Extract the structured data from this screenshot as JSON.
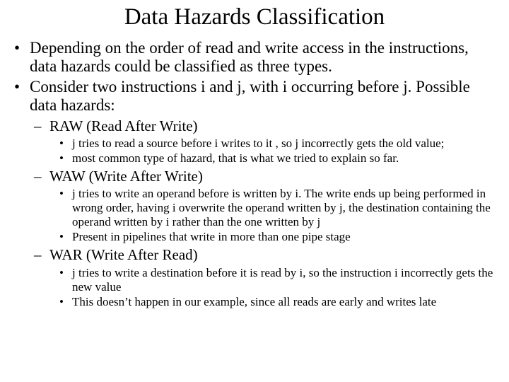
{
  "title": "Data Hazards Classification",
  "bullets": {
    "b1": "Depending on the order of read and write access in the instructions, data hazards could be classified as three types.",
    "b2": "Consider two instructions i and j, with i occurring before j. Possible data hazards:",
    "raw": {
      "heading": "RAW (Read After Write)",
      "p1": "j tries to read a source before i writes to it , so j incorrectly gets the old value;",
      "p2": "most common type of hazard, that is what we tried to explain so far."
    },
    "waw": {
      "heading": "WAW (Write After Write)",
      "p1": "j tries to write an operand before is written by i. The write ends up being performed in wrong order, having i overwrite the operand written by j, the destination containing the operand written by i rather than the one written by j",
      "p2": "Present in pipelines that write in more than one pipe stage"
    },
    "war": {
      "heading": "WAR (Write After Read)",
      "p1": "j tries to write a destination before it is read by i, so the instruction i incorrectly gets the new value",
      "p2": "This doesn’t happen in our example, since all reads are early and writes late"
    }
  }
}
